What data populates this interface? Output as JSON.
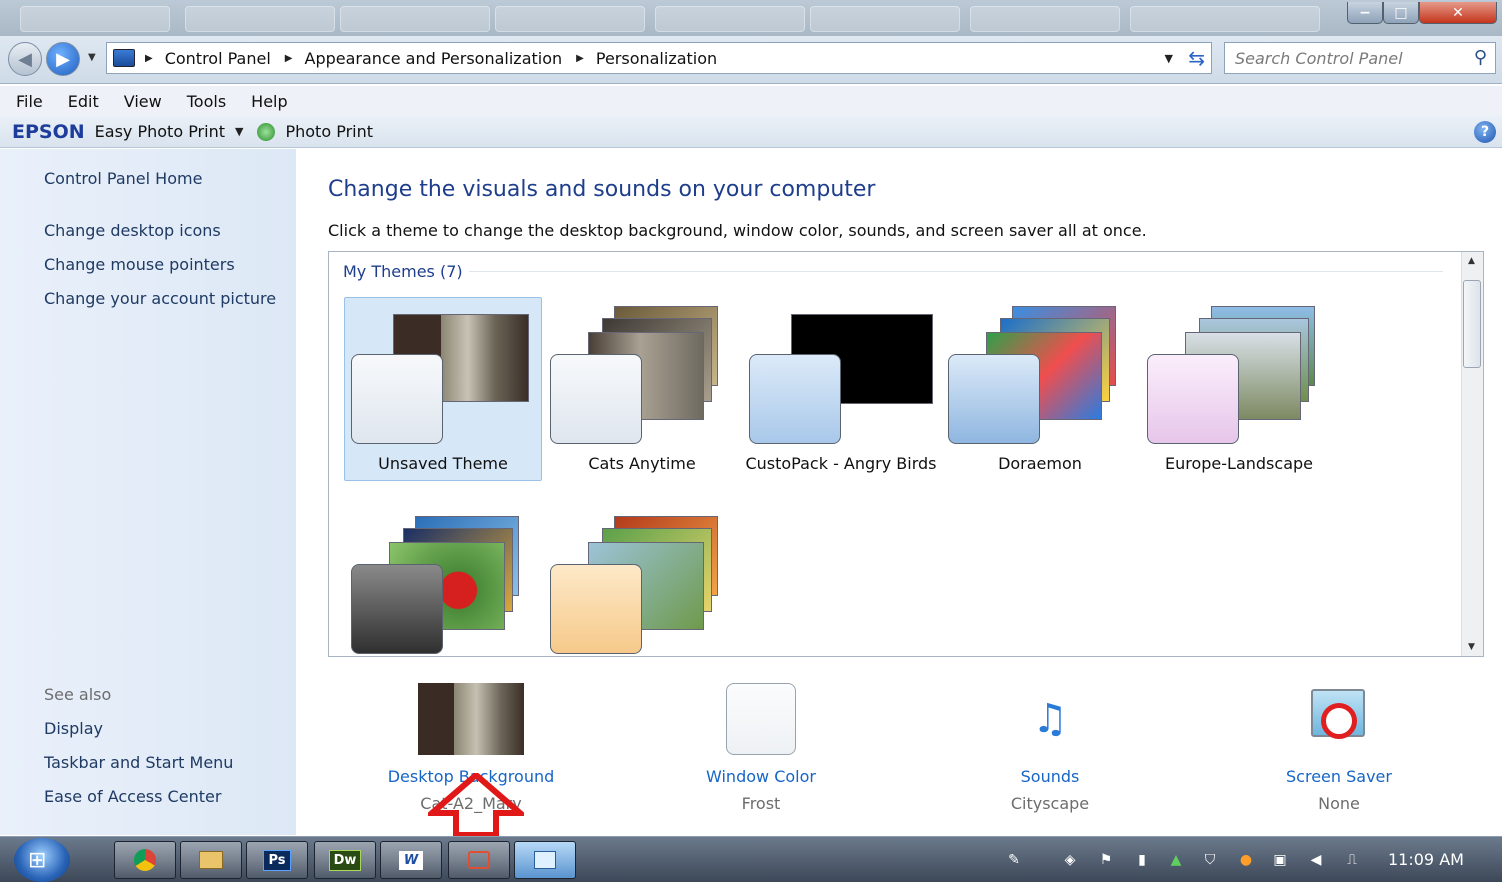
{
  "window": {
    "minimize_glyph": "−",
    "maximize_glyph": "□",
    "close_glyph": "✕"
  },
  "address": {
    "crumbs": [
      "Control Panel",
      "Appearance and Personalization",
      "Personalization"
    ],
    "search_placeholder": "Search Control Panel"
  },
  "menu": [
    "File",
    "Edit",
    "View",
    "Tools",
    "Help"
  ],
  "toolbar": {
    "brand": "EPSON",
    "easy_photo": "Easy Photo Print",
    "photo_print": "Photo Print"
  },
  "sidebar": {
    "home": "Control Panel Home",
    "links": [
      "Change desktop icons",
      "Change mouse pointers",
      "Change your account picture"
    ],
    "see_also": "See also",
    "see_also_links": [
      "Display",
      "Taskbar and Start Menu",
      "Ease of Access Center"
    ]
  },
  "main": {
    "title": "Change the visuals and sounds on your computer",
    "subtitle": "Click a theme to change the desktop background, window color, sounds, and screen saver all at once.",
    "group": "My Themes (7)",
    "themes": [
      {
        "name": "Unsaved Theme",
        "selected": true
      },
      {
        "name": "Cats Anytime"
      },
      {
        "name": "CustoPack - Angry Birds"
      },
      {
        "name": "Doraemon"
      },
      {
        "name": "Europe-Landscape"
      },
      {
        "name": ""
      },
      {
        "name": ""
      }
    ],
    "settings": [
      {
        "label": "Desktop Background",
        "value": "Cat-A2_Mary"
      },
      {
        "label": "Window Color",
        "value": "Frost"
      },
      {
        "label": "Sounds",
        "value": "Cityscape"
      },
      {
        "label": "Screen Saver",
        "value": "None"
      }
    ]
  },
  "taskbar": {
    "apps": [
      "Ps",
      "Dw",
      "W"
    ],
    "clock": "11:09 AM"
  },
  "colors": {
    "accent": "#1e3e8c",
    "link": "#1665c7",
    "arrow": "#e01818"
  }
}
